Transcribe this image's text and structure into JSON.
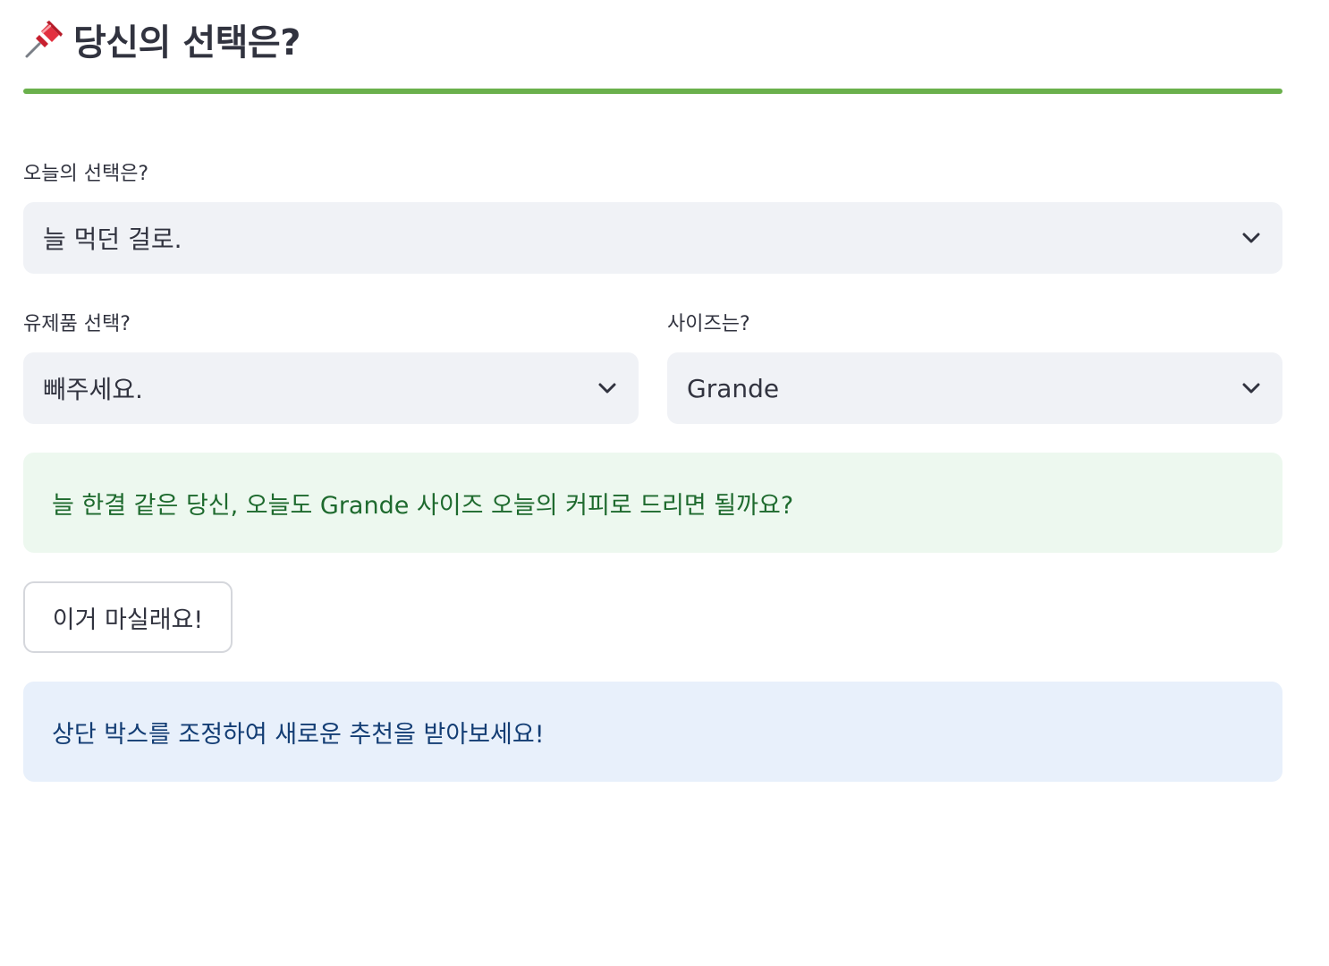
{
  "header": {
    "icon": "pushpin-icon",
    "title": "당신의 선택은?",
    "divider_color": "#6ab04c"
  },
  "drink_select": {
    "label": "오늘의 선택은?",
    "value": "늘 먹던 걸로.",
    "icon": "chevron-down-icon"
  },
  "dairy_select": {
    "label": "유제품 선택?",
    "value": "빼주세요.",
    "icon": "chevron-down-icon"
  },
  "size_select": {
    "label": "사이즈는?",
    "value": "Grande",
    "icon": "chevron-down-icon"
  },
  "success_message": {
    "text": "늘 한결 같은 당신, 오늘도 Grande 사이즈 오늘의 커피로 드리면 될까요?",
    "color": "#1e6a2e",
    "background": "#edf8ef"
  },
  "order_button": {
    "label": "이거 마실래요!"
  },
  "info_message": {
    "text": "상단 박스를 조정하여 새로운 추천을 받아보세요!",
    "color": "#133d74",
    "background": "#e8f0fb"
  }
}
